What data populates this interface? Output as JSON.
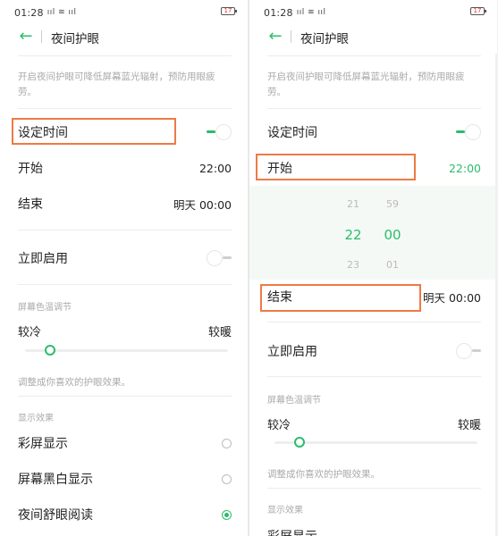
{
  "status": {
    "time": "01:28",
    "signal": "5G ull 令 ull",
    "battery": "17"
  },
  "header": {
    "title": "夜间护眼"
  },
  "description": "开启夜间护眼可降低屏幕蓝光辐射，预防用眼疲劳。",
  "schedule": {
    "label": "设定时间",
    "enabled": true
  },
  "start": {
    "label": "开始",
    "value": "22:00"
  },
  "end": {
    "label": "结束",
    "value": "明天 00:00"
  },
  "instant": {
    "label": "立即启用",
    "enabled": false
  },
  "temperature": {
    "section": "屏幕色温调节",
    "cool": "较冷",
    "warm": "较暖",
    "level": 0.1,
    "hint": "调整成你喜欢的护眼效果。"
  },
  "display": {
    "section": "显示效果",
    "options": [
      {
        "label": "彩屏显示",
        "selected": false
      },
      {
        "label": "屏幕黑白显示",
        "selected": false
      },
      {
        "label": "夜间舒眼阅读",
        "selected": true
      }
    ]
  },
  "picker": {
    "hours": [
      "21",
      "22",
      "23"
    ],
    "minutes": [
      "59",
      "00",
      "01"
    ]
  },
  "partial_option": "彩屏显示",
  "colors": {
    "accent": "#2bbd6a",
    "highlight": "#ee7a45"
  }
}
